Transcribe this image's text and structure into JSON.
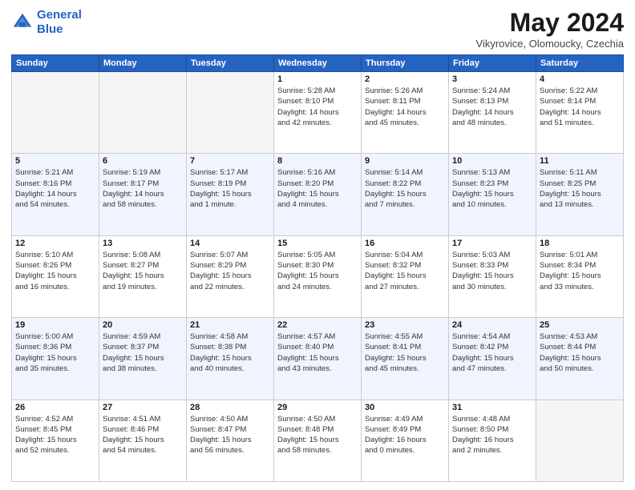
{
  "logo": {
    "line1": "General",
    "line2": "Blue"
  },
  "title": "May 2024",
  "subtitle": "Vikyrovice, Olomoucky, Czechia",
  "days_of_week": [
    "Sunday",
    "Monday",
    "Tuesday",
    "Wednesday",
    "Thursday",
    "Friday",
    "Saturday"
  ],
  "weeks": [
    {
      "alt": false,
      "days": [
        {
          "num": "",
          "info": ""
        },
        {
          "num": "",
          "info": ""
        },
        {
          "num": "",
          "info": ""
        },
        {
          "num": "1",
          "info": "Sunrise: 5:28 AM\nSunset: 8:10 PM\nDaylight: 14 hours\nand 42 minutes."
        },
        {
          "num": "2",
          "info": "Sunrise: 5:26 AM\nSunset: 8:11 PM\nDaylight: 14 hours\nand 45 minutes."
        },
        {
          "num": "3",
          "info": "Sunrise: 5:24 AM\nSunset: 8:13 PM\nDaylight: 14 hours\nand 48 minutes."
        },
        {
          "num": "4",
          "info": "Sunrise: 5:22 AM\nSunset: 8:14 PM\nDaylight: 14 hours\nand 51 minutes."
        }
      ]
    },
    {
      "alt": true,
      "days": [
        {
          "num": "5",
          "info": "Sunrise: 5:21 AM\nSunset: 8:16 PM\nDaylight: 14 hours\nand 54 minutes."
        },
        {
          "num": "6",
          "info": "Sunrise: 5:19 AM\nSunset: 8:17 PM\nDaylight: 14 hours\nand 58 minutes."
        },
        {
          "num": "7",
          "info": "Sunrise: 5:17 AM\nSunset: 8:19 PM\nDaylight: 15 hours\nand 1 minute."
        },
        {
          "num": "8",
          "info": "Sunrise: 5:16 AM\nSunset: 8:20 PM\nDaylight: 15 hours\nand 4 minutes."
        },
        {
          "num": "9",
          "info": "Sunrise: 5:14 AM\nSunset: 8:22 PM\nDaylight: 15 hours\nand 7 minutes."
        },
        {
          "num": "10",
          "info": "Sunrise: 5:13 AM\nSunset: 8:23 PM\nDaylight: 15 hours\nand 10 minutes."
        },
        {
          "num": "11",
          "info": "Sunrise: 5:11 AM\nSunset: 8:25 PM\nDaylight: 15 hours\nand 13 minutes."
        }
      ]
    },
    {
      "alt": false,
      "days": [
        {
          "num": "12",
          "info": "Sunrise: 5:10 AM\nSunset: 8:26 PM\nDaylight: 15 hours\nand 16 minutes."
        },
        {
          "num": "13",
          "info": "Sunrise: 5:08 AM\nSunset: 8:27 PM\nDaylight: 15 hours\nand 19 minutes."
        },
        {
          "num": "14",
          "info": "Sunrise: 5:07 AM\nSunset: 8:29 PM\nDaylight: 15 hours\nand 22 minutes."
        },
        {
          "num": "15",
          "info": "Sunrise: 5:05 AM\nSunset: 8:30 PM\nDaylight: 15 hours\nand 24 minutes."
        },
        {
          "num": "16",
          "info": "Sunrise: 5:04 AM\nSunset: 8:32 PM\nDaylight: 15 hours\nand 27 minutes."
        },
        {
          "num": "17",
          "info": "Sunrise: 5:03 AM\nSunset: 8:33 PM\nDaylight: 15 hours\nand 30 minutes."
        },
        {
          "num": "18",
          "info": "Sunrise: 5:01 AM\nSunset: 8:34 PM\nDaylight: 15 hours\nand 33 minutes."
        }
      ]
    },
    {
      "alt": true,
      "days": [
        {
          "num": "19",
          "info": "Sunrise: 5:00 AM\nSunset: 8:36 PM\nDaylight: 15 hours\nand 35 minutes."
        },
        {
          "num": "20",
          "info": "Sunrise: 4:59 AM\nSunset: 8:37 PM\nDaylight: 15 hours\nand 38 minutes."
        },
        {
          "num": "21",
          "info": "Sunrise: 4:58 AM\nSunset: 8:38 PM\nDaylight: 15 hours\nand 40 minutes."
        },
        {
          "num": "22",
          "info": "Sunrise: 4:57 AM\nSunset: 8:40 PM\nDaylight: 15 hours\nand 43 minutes."
        },
        {
          "num": "23",
          "info": "Sunrise: 4:55 AM\nSunset: 8:41 PM\nDaylight: 15 hours\nand 45 minutes."
        },
        {
          "num": "24",
          "info": "Sunrise: 4:54 AM\nSunset: 8:42 PM\nDaylight: 15 hours\nand 47 minutes."
        },
        {
          "num": "25",
          "info": "Sunrise: 4:53 AM\nSunset: 8:44 PM\nDaylight: 15 hours\nand 50 minutes."
        }
      ]
    },
    {
      "alt": false,
      "days": [
        {
          "num": "26",
          "info": "Sunrise: 4:52 AM\nSunset: 8:45 PM\nDaylight: 15 hours\nand 52 minutes."
        },
        {
          "num": "27",
          "info": "Sunrise: 4:51 AM\nSunset: 8:46 PM\nDaylight: 15 hours\nand 54 minutes."
        },
        {
          "num": "28",
          "info": "Sunrise: 4:50 AM\nSunset: 8:47 PM\nDaylight: 15 hours\nand 56 minutes."
        },
        {
          "num": "29",
          "info": "Sunrise: 4:50 AM\nSunset: 8:48 PM\nDaylight: 15 hours\nand 58 minutes."
        },
        {
          "num": "30",
          "info": "Sunrise: 4:49 AM\nSunset: 8:49 PM\nDaylight: 16 hours\nand 0 minutes."
        },
        {
          "num": "31",
          "info": "Sunrise: 4:48 AM\nSunset: 8:50 PM\nDaylight: 16 hours\nand 2 minutes."
        },
        {
          "num": "",
          "info": ""
        }
      ]
    }
  ]
}
